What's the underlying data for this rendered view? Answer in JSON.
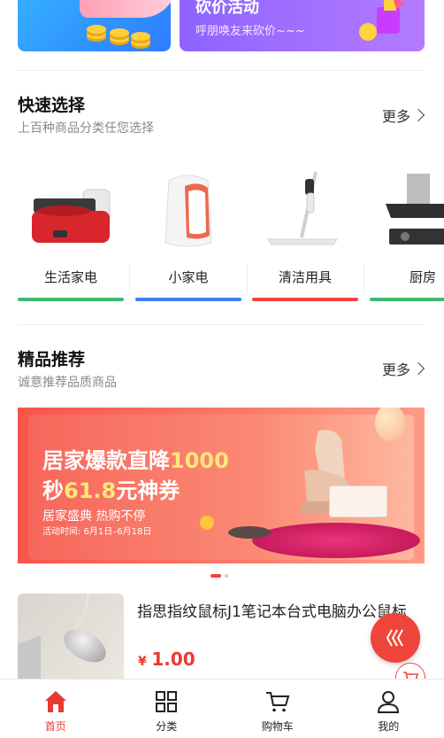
{
  "top_banners": {
    "right_title": "砍价活动",
    "right_subtitle": "呼朋唤友来砍价~~~"
  },
  "quick_select": {
    "title": "快速选择",
    "subtitle": "上百种商品分类任您选择",
    "more_label": "更多",
    "categories": [
      {
        "label": "生活家电",
        "bar_color": "#3dba6f"
      },
      {
        "label": "小家电",
        "bar_color": "#3b82f0"
      },
      {
        "label": "清洁用具",
        "bar_color": "#f0453a"
      },
      {
        "label": "厨房",
        "bar_color": "#3dba6f"
      }
    ]
  },
  "recommend": {
    "title": "精品推荐",
    "subtitle": "诚意推荐品质商品",
    "more_label": "更多"
  },
  "promo_banner": {
    "line1_a": "居家爆款直降",
    "line1_b": "1000",
    "line2_a": "秒",
    "line2_b": "61.8",
    "line2_c": "元神券",
    "line3": "居家盛典 热购不停",
    "line4": "活动时间: 6月1日–6月18日",
    "slide_count": 2,
    "active_slide": 1
  },
  "product": {
    "title": "指思指纹鼠标J1笔记本台式电脑办公鼠标",
    "currency": "¥",
    "price": "1.00"
  },
  "tabbar": {
    "items": [
      {
        "label": "首页",
        "icon": "home-icon",
        "active": true
      },
      {
        "label": "分类",
        "icon": "grid-icon",
        "active": false
      },
      {
        "label": "购物车",
        "icon": "cart-icon",
        "active": false
      },
      {
        "label": "我的",
        "icon": "user-icon",
        "active": false
      }
    ]
  },
  "colors": {
    "accent": "#e83b2f",
    "floating_button": "#f0453a"
  }
}
